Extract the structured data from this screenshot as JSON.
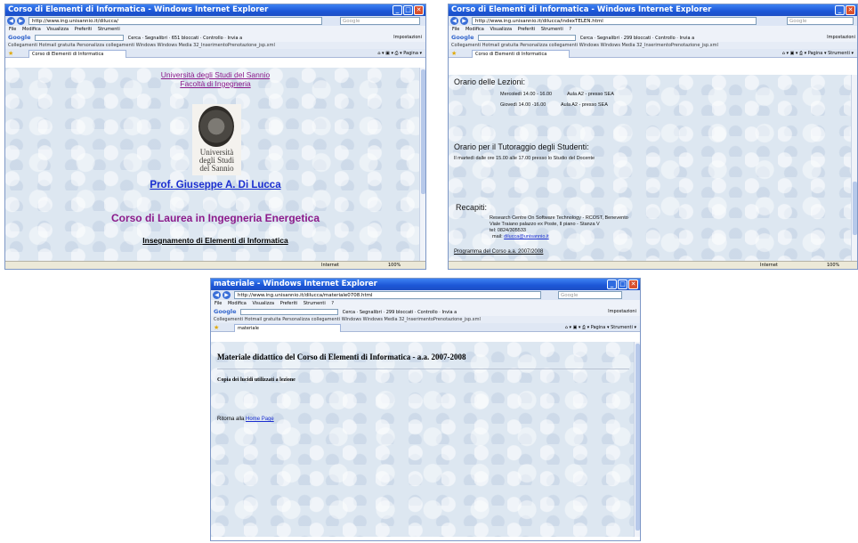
{
  "window1": {
    "title": "Corso di Elementi di Informatica - Windows Internet Explorer",
    "url": "http://www.ing.unisannio.it/dilucca/",
    "search_placeholder": "Google",
    "tab_label": "Corso di Elementi di Informatica",
    "university": "Università degli Studi del Sannio",
    "faculty": "Facoltà di Ingegneria",
    "logo_text": [
      "Università",
      "degli Studi",
      "del Sannio"
    ],
    "professor": "Prof. Giuseppe A. Di Lucca",
    "degree": "Corso di Laurea in Ingegneria Energetica",
    "course": "Insegnamento di Elementi di Informatica",
    "status_zone": "Internet",
    "zoom": "100%"
  },
  "window2": {
    "title": "Corso di Elementi di Informatica - Windows Internet Explorer",
    "url": "http://www.ing.unisannio.it/dilucca/indexTELEN.html",
    "search_placeholder": "Google",
    "tab_label": "Corso di Elementi di Informatica",
    "menu": [
      "File",
      "Modifica",
      "Visualizza",
      "Preferiti",
      "Strumenti",
      "?"
    ],
    "blocked": "299 bloccati",
    "schedule_title": "Orario delle Lezioni:",
    "schedule": [
      {
        "day": "Mercoledì 14.00 - 16.00",
        "room": "Aula A2 - presso SEA"
      },
      {
        "day": "Giovedì 14.00 -16.00",
        "room": "Aula A2 - presso SEA"
      }
    ],
    "tutoring_title": "Orario per il Tutoraggio degli Studenti:",
    "tutoring_text": "Il martedì dalle ore 15.00 alle 17.00 presso lo Studio del Docente",
    "contacts_title": "Recapiti:",
    "contacts": [
      "Research Centre On Software Technology - RCOST, Benevento",
      "Viale Traiano palazzo ex Poste, II piano - Stanza V",
      "tel: 0824/305533"
    ],
    "mail_label": "mail:",
    "mail": "dilucca@unisannio.it",
    "program_link": "Programma del Corso a.a. 2007/2008",
    "status_zone": "Internet",
    "zoom": "100%"
  },
  "window3": {
    "title": "materiale - Windows Internet Explorer",
    "url": "http://www.ing.unisannio.it/dilucca/materiale0708.html",
    "search_placeholder": "Google",
    "tab_label": "materiale",
    "menu": [
      "File",
      "Modifica",
      "Visualizza",
      "Preferiti",
      "Strumenti",
      "?"
    ],
    "blocked": "299 bloccati",
    "heading": "Materiale didattico del Corso di Elementi di Informatica - a.a. 2007-2008",
    "subheading": "Copia dei lucidi utilizzati a lezione",
    "return_text": "Ritorna alla",
    "home_link": "Home Page"
  },
  "common": {
    "google": "Google",
    "cerca": "Cerca",
    "segnalibri": "Segnalibri",
    "controllo": "Controllo",
    "invia": "Invia a",
    "impostazioni": "Impostazioni",
    "links_bar": "Collegamenti  Hotmail gratuita  Personalizza collegamenti  Windows  Windows Media  32_InserimentoPrenotazione_jsp.xml",
    "pagina": "Pagina",
    "strumenti": "Strumenti",
    "window1_blocked": "651 bloccati"
  }
}
